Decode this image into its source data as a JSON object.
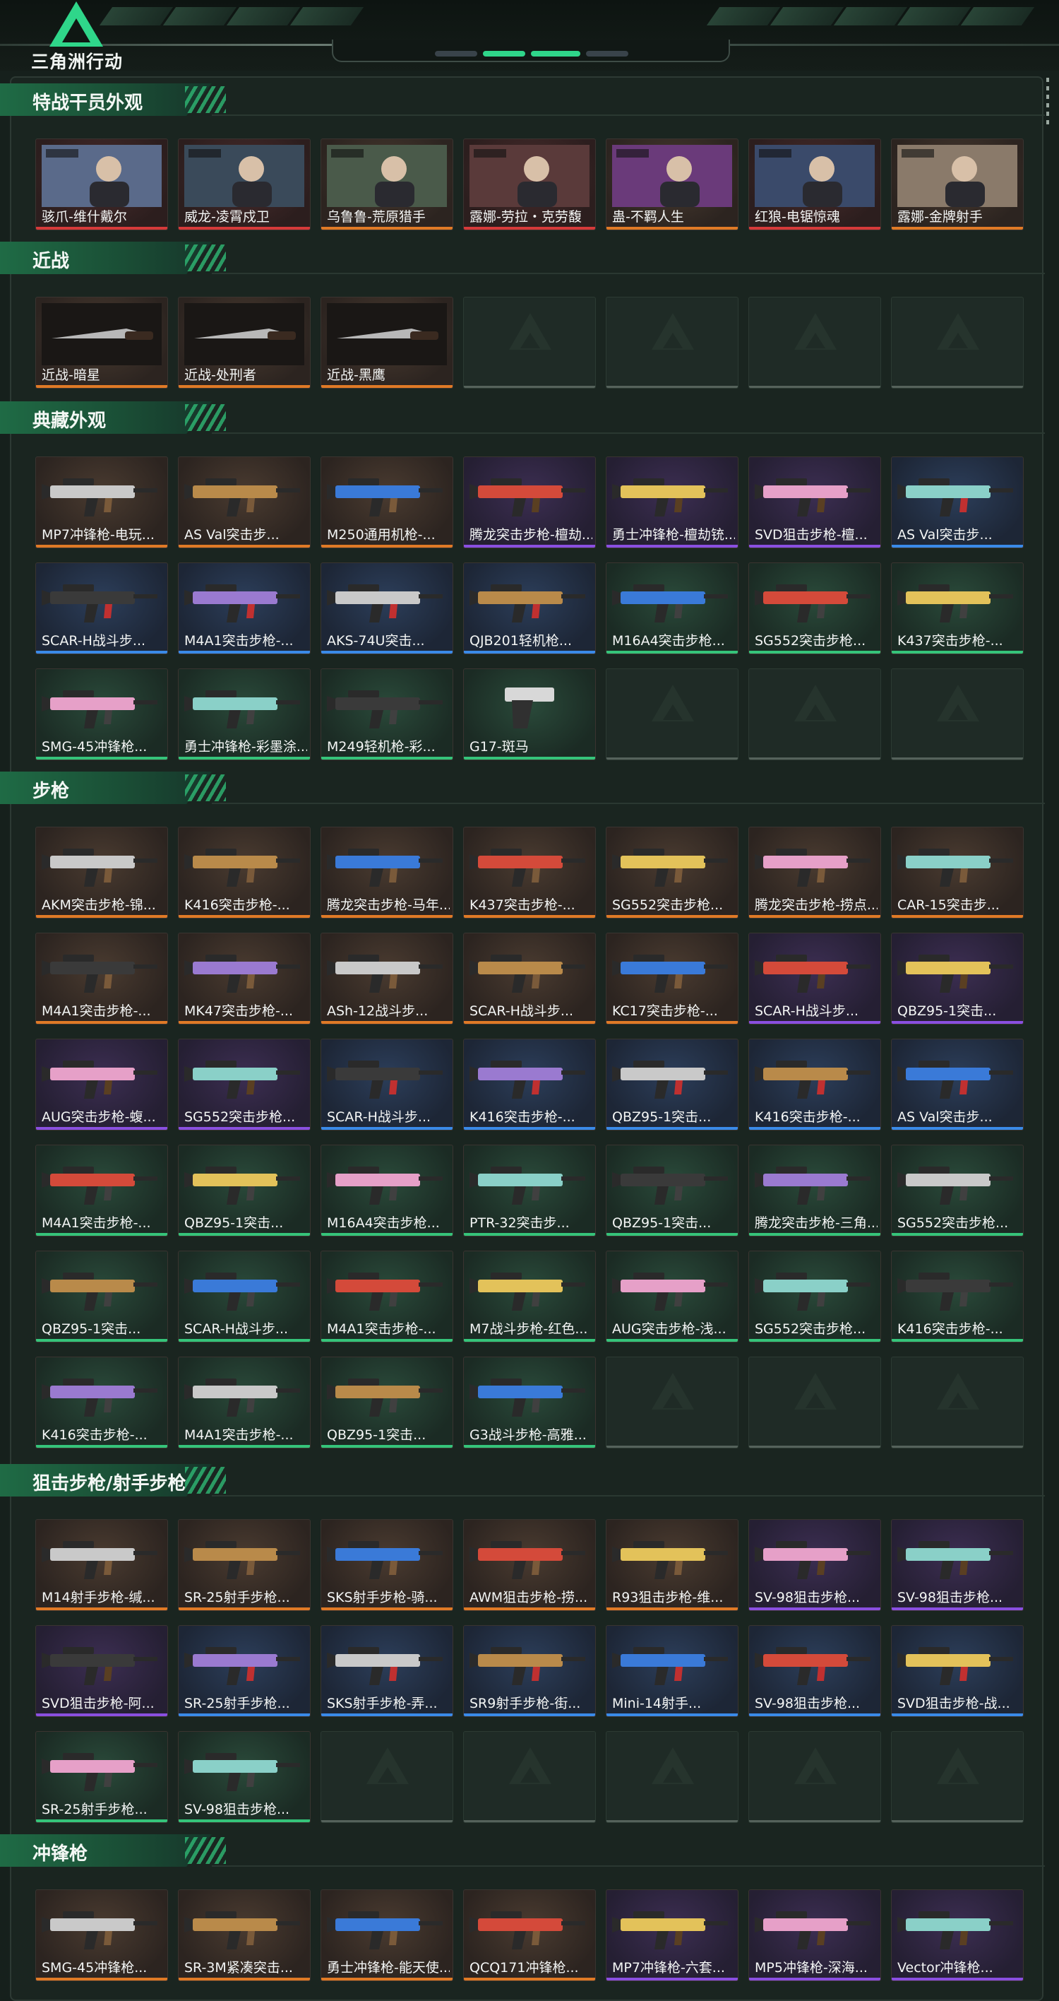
{
  "app": {
    "title": "三角洲行动"
  },
  "colors": {
    "accent": "#2fd68a",
    "rarity_orange": "#e07a26",
    "rarity_purple": "#8a4fe0",
    "rarity_blue": "#3a8ae8",
    "rarity_green": "#35c47a",
    "rarity_gold": "#d89a2a",
    "rarity_red": "#d63a3a"
  },
  "sections": [
    {
      "title": "特战干员外观",
      "rows": 1,
      "items": [
        {
          "name": "骇爪-维什戴尔",
          "rarity": "red",
          "icon": "operator-portrait"
        },
        {
          "name": "威龙-凌霄戍卫",
          "rarity": "red",
          "icon": "operator-portrait"
        },
        {
          "name": "乌鲁鲁-荒原猎手",
          "rarity": "orange",
          "icon": "operator-portrait"
        },
        {
          "name": "露娜-劳拉・克劳馥",
          "rarity": "red",
          "icon": "operator-portrait"
        },
        {
          "name": "蛊-不羁人生",
          "rarity": "orange",
          "icon": "operator-portrait"
        },
        {
          "name": "红狼-电锯惊魂",
          "rarity": "red",
          "icon": "operator-portrait"
        },
        {
          "name": "露娜-金牌射手",
          "rarity": "orange",
          "icon": "operator-portrait"
        }
      ]
    },
    {
      "title": "近战",
      "rows": 1,
      "items": [
        {
          "name": "近战-暗星",
          "rarity": "orange",
          "icon": "melee-weapon"
        },
        {
          "name": "近战-处刑者",
          "rarity": "orange",
          "icon": "melee-weapon"
        },
        {
          "name": "近战-黑鹰",
          "rarity": "orange",
          "icon": "melee-weapon"
        }
      ]
    },
    {
      "title": "典藏外观",
      "rows": 3,
      "items": [
        {
          "name": "MP7冲锋枪-电玩...",
          "rarity": "orange",
          "icon": "gun"
        },
        {
          "name": "AS Val突击步...",
          "rarity": "orange",
          "icon": "gun"
        },
        {
          "name": "M250通用机枪-...",
          "rarity": "orange",
          "icon": "gun"
        },
        {
          "name": "腾龙突击步枪-檀劫...",
          "rarity": "purple",
          "icon": "gun"
        },
        {
          "name": "勇士冲锋枪-檀劫铳...",
          "rarity": "purple",
          "icon": "gun"
        },
        {
          "name": "SVD狙击步枪-檀...",
          "rarity": "purple",
          "icon": "gun"
        },
        {
          "name": "AS Val突击步...",
          "rarity": "blue",
          "icon": "gun"
        },
        {
          "name": "SCAR-H战斗步...",
          "rarity": "blue",
          "icon": "gun"
        },
        {
          "name": "M4A1突击步枪-...",
          "rarity": "blue",
          "icon": "gun"
        },
        {
          "name": "AKS-74U突击...",
          "rarity": "blue",
          "icon": "gun"
        },
        {
          "name": "QJB201轻机枪...",
          "rarity": "blue",
          "icon": "gun"
        },
        {
          "name": "M16A4突击步枪...",
          "rarity": "green",
          "icon": "gun"
        },
        {
          "name": "SG552突击步枪...",
          "rarity": "green",
          "icon": "gun"
        },
        {
          "name": "K437突击步枪-...",
          "rarity": "green",
          "icon": "gun"
        },
        {
          "name": "SMG-45冲锋枪...",
          "rarity": "green",
          "icon": "gun"
        },
        {
          "name": "勇士冲锋枪-彩墨涂...",
          "rarity": "green",
          "icon": "gun"
        },
        {
          "name": "M249轻机枪-彩...",
          "rarity": "green",
          "icon": "gun"
        },
        {
          "name": "G17-斑马",
          "rarity": "green",
          "icon": "pistol"
        }
      ]
    },
    {
      "title": "步枪",
      "rows": 6,
      "items": [
        {
          "name": "AKM突击步枪-锦...",
          "rarity": "orange",
          "icon": "gun"
        },
        {
          "name": "K416突击步枪-...",
          "rarity": "orange",
          "icon": "gun"
        },
        {
          "name": "腾龙突击步枪-马年...",
          "rarity": "orange",
          "icon": "gun"
        },
        {
          "name": "K437突击步枪-...",
          "rarity": "orange",
          "icon": "gun"
        },
        {
          "name": "SG552突击步枪...",
          "rarity": "orange",
          "icon": "gun"
        },
        {
          "name": "腾龙突击步枪-捞点...",
          "rarity": "orange",
          "icon": "gun"
        },
        {
          "name": "CAR-15突击步...",
          "rarity": "orange",
          "icon": "gun"
        },
        {
          "name": "M4A1突击步枪-...",
          "rarity": "orange",
          "icon": "gun"
        },
        {
          "name": "MK47突击步枪-...",
          "rarity": "orange",
          "icon": "gun"
        },
        {
          "name": "ASh-12战斗步...",
          "rarity": "orange",
          "icon": "gun"
        },
        {
          "name": "SCAR-H战斗步...",
          "rarity": "orange",
          "icon": "gun"
        },
        {
          "name": "KC17突击步枪-...",
          "rarity": "orange",
          "icon": "gun"
        },
        {
          "name": "SCAR-H战斗步...",
          "rarity": "purple",
          "icon": "gun"
        },
        {
          "name": "QBZ95-1突击...",
          "rarity": "purple",
          "icon": "gun"
        },
        {
          "name": "AUG突击步枪-蝮...",
          "rarity": "purple",
          "icon": "gun"
        },
        {
          "name": "SG552突击步枪...",
          "rarity": "purple",
          "icon": "gun"
        },
        {
          "name": "SCAR-H战斗步...",
          "rarity": "blue",
          "icon": "gun"
        },
        {
          "name": "K416突击步枪-...",
          "rarity": "blue",
          "icon": "gun"
        },
        {
          "name": "QBZ95-1突击...",
          "rarity": "blue",
          "icon": "gun"
        },
        {
          "name": "K416突击步枪-...",
          "rarity": "blue",
          "icon": "gun"
        },
        {
          "name": "AS Val突击步...",
          "rarity": "blue",
          "icon": "gun"
        },
        {
          "name": "M4A1突击步枪-...",
          "rarity": "green",
          "icon": "gun"
        },
        {
          "name": "QBZ95-1突击...",
          "rarity": "green",
          "icon": "gun"
        },
        {
          "name": "M16A4突击步枪...",
          "rarity": "green",
          "icon": "gun"
        },
        {
          "name": "PTR-32突击步...",
          "rarity": "green",
          "icon": "gun"
        },
        {
          "name": "QBZ95-1突击...",
          "rarity": "green",
          "icon": "gun"
        },
        {
          "name": "腾龙突击步枪-三角...",
          "rarity": "green",
          "icon": "gun"
        },
        {
          "name": "SG552突击步枪...",
          "rarity": "green",
          "icon": "gun"
        },
        {
          "name": "QBZ95-1突击...",
          "rarity": "green",
          "icon": "gun"
        },
        {
          "name": "SCAR-H战斗步...",
          "rarity": "green",
          "icon": "gun"
        },
        {
          "name": "M4A1突击步枪-...",
          "rarity": "green",
          "icon": "gun"
        },
        {
          "name": "M7战斗步枪-红色...",
          "rarity": "green",
          "icon": "gun"
        },
        {
          "name": "AUG突击步枪-浅...",
          "rarity": "green",
          "icon": "gun"
        },
        {
          "name": "SG552突击步枪...",
          "rarity": "green",
          "icon": "gun"
        },
        {
          "name": "K416突击步枪-...",
          "rarity": "green",
          "icon": "gun"
        },
        {
          "name": "K416突击步枪-...",
          "rarity": "green",
          "icon": "gun"
        },
        {
          "name": "M4A1突击步枪-...",
          "rarity": "green",
          "icon": "gun"
        },
        {
          "name": "QBZ95-1突击...",
          "rarity": "green",
          "icon": "gun"
        },
        {
          "name": "G3战斗步枪-高雅...",
          "rarity": "green",
          "icon": "gun"
        }
      ]
    },
    {
      "title": "狙击步枪/射手步枪",
      "rows": 3,
      "items": [
        {
          "name": "M14射手步枪-缄...",
          "rarity": "orange",
          "icon": "gun"
        },
        {
          "name": "SR-25射手步枪...",
          "rarity": "orange",
          "icon": "gun"
        },
        {
          "name": "SKS射手步枪-骑...",
          "rarity": "orange",
          "icon": "gun"
        },
        {
          "name": "AWM狙击步枪-捞...",
          "rarity": "orange",
          "icon": "gun"
        },
        {
          "name": "R93狙击步枪-维...",
          "rarity": "orange",
          "icon": "gun"
        },
        {
          "name": "SV-98狙击步枪...",
          "rarity": "purple",
          "icon": "gun"
        },
        {
          "name": "SV-98狙击步枪...",
          "rarity": "purple",
          "icon": "gun"
        },
        {
          "name": "SVD狙击步枪-阿...",
          "rarity": "purple",
          "icon": "gun"
        },
        {
          "name": "SR-25射手步枪...",
          "rarity": "blue",
          "icon": "gun"
        },
        {
          "name": "SKS射手步枪-弄...",
          "rarity": "blue",
          "icon": "gun"
        },
        {
          "name": "SR9射手步枪-街...",
          "rarity": "blue",
          "icon": "gun"
        },
        {
          "name": "Mini-14射手...",
          "rarity": "blue",
          "icon": "gun"
        },
        {
          "name": "SV-98狙击步枪...",
          "rarity": "blue",
          "icon": "gun"
        },
        {
          "name": "SVD狙击步枪-战...",
          "rarity": "blue",
          "icon": "gun"
        },
        {
          "name": "SR-25射手步枪...",
          "rarity": "green",
          "icon": "gun"
        },
        {
          "name": "SV-98狙击步枪...",
          "rarity": "green",
          "icon": "gun"
        }
      ]
    },
    {
      "title": "冲锋枪",
      "rows": 1,
      "items": [
        {
          "name": "SMG-45冲锋枪...",
          "rarity": "orange",
          "icon": "gun"
        },
        {
          "name": "SR-3M紧凑突击...",
          "rarity": "orange",
          "icon": "gun"
        },
        {
          "name": "勇士冲锋枪-能天使...",
          "rarity": "orange",
          "icon": "gun"
        },
        {
          "name": "QCQ171冲锋枪...",
          "rarity": "orange",
          "icon": "gun"
        },
        {
          "name": "MP7冲锋枪-六套...",
          "rarity": "purple",
          "icon": "gun"
        },
        {
          "name": "MP5冲锋枪-深海...",
          "rarity": "purple",
          "icon": "gun"
        },
        {
          "name": "Vector冲锋枪...",
          "rarity": "purple",
          "icon": "gun"
        }
      ]
    }
  ]
}
